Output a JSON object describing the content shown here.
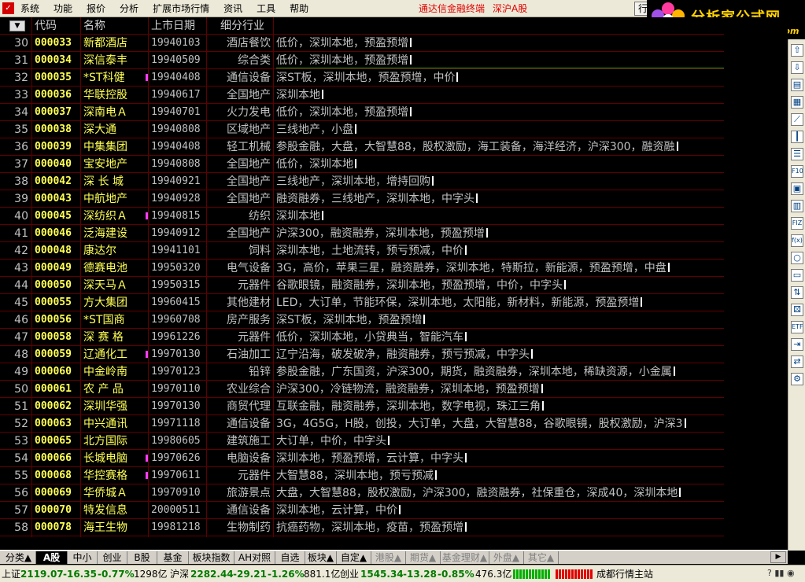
{
  "menu": {
    "app_icon": "app-logo-icon",
    "items": [
      "系统",
      "功能",
      "报价",
      "分析",
      "扩展市场行情",
      "资讯",
      "工具",
      "帮助"
    ],
    "title": "通达信金融终端",
    "market": "深沪A股",
    "market_button": "行"
  },
  "logo": {
    "title": "分析家公式网",
    "url": "www.88gs.com"
  },
  "table": {
    "sort_icon": "triangle-down-icon",
    "headers": {
      "code": "代码",
      "name": "名称",
      "date": "上市日期",
      "industry": "细分行业"
    },
    "rows": [
      {
        "no": "30",
        "code": "000033",
        "name": "新都酒店",
        "date": "19940103",
        "industry": "酒店餐饮",
        "notes": "低价，深圳本地，预盈预增",
        "flag": false
      },
      {
        "no": "31",
        "code": "000034",
        "name": "深信泰丰",
        "date": "19940509",
        "industry": "综合类",
        "notes": "低价，深圳本地，预盈预增",
        "flag": false
      },
      {
        "no": "32",
        "code": "000035",
        "name": "*ST科健",
        "date": "19940408",
        "industry": "通信设备",
        "notes": "深ST板，深圳本地，预盈预增，中价",
        "flag": true
      },
      {
        "no": "33",
        "code": "000036",
        "name": "华联控股",
        "date": "19940617",
        "industry": "全国地产",
        "notes": "深圳本地",
        "flag": false
      },
      {
        "no": "34",
        "code": "000037",
        "name": "深南电Ａ",
        "date": "19940701",
        "industry": "火力发电",
        "notes": "低价，深圳本地，预盈预增",
        "flag": false
      },
      {
        "no": "35",
        "code": "000038",
        "name": "深大通",
        "date": "19940808",
        "industry": "区域地产",
        "notes": "三线地产，小盘",
        "flag": false
      },
      {
        "no": "36",
        "code": "000039",
        "name": "中集集团",
        "date": "19940408",
        "industry": "轻工机械",
        "notes": "参股金融，大盘，大智慧88，股权激励，海工装备，海洋经济，沪深300，融资融",
        "flag": false
      },
      {
        "no": "37",
        "code": "000040",
        "name": "宝安地产",
        "date": "19940808",
        "industry": "全国地产",
        "notes": "低价，深圳本地",
        "flag": false
      },
      {
        "no": "38",
        "code": "000042",
        "name": "深 长 城",
        "date": "19940921",
        "industry": "全国地产",
        "notes": "三线地产，深圳本地，增持回购",
        "flag": false
      },
      {
        "no": "39",
        "code": "000043",
        "name": "中航地产",
        "date": "19940928",
        "industry": "全国地产",
        "notes": "融资融券，三线地产，深圳本地，中字头",
        "flag": false
      },
      {
        "no": "40",
        "code": "000045",
        "name": "深纺织Ａ",
        "date": "19940815",
        "industry": "纺织",
        "notes": "深圳本地",
        "flag": true
      },
      {
        "no": "41",
        "code": "000046",
        "name": "泛海建设",
        "date": "19940912",
        "industry": "全国地产",
        "notes": "沪深300，融资融券，深圳本地，预盈预增",
        "flag": false
      },
      {
        "no": "42",
        "code": "000048",
        "name": "康达尔",
        "date": "19941101",
        "industry": "饲料",
        "notes": "深圳本地，土地流转，预亏预减，中价",
        "flag": false
      },
      {
        "no": "43",
        "code": "000049",
        "name": "德赛电池",
        "date": "19950320",
        "industry": "电气设备",
        "notes": "3G，高价，苹果三星，融资融券，深圳本地，特斯拉，新能源，预盈预增，中盘",
        "flag": false
      },
      {
        "no": "44",
        "code": "000050",
        "name": "深天马Ａ",
        "date": "19950315",
        "industry": "元器件",
        "notes": "谷歌眼镜，融资融券，深圳本地，预盈预增，中价，中字头",
        "flag": false
      },
      {
        "no": "45",
        "code": "000055",
        "name": "方大集团",
        "date": "19960415",
        "industry": "其他建材",
        "notes": "LED，大订单，节能环保，深圳本地，太阳能，新材料，新能源，预盈预增",
        "flag": false
      },
      {
        "no": "46",
        "code": "000056",
        "name": "*ST国商",
        "date": "19960708",
        "industry": "房产服务",
        "notes": "深ST板，深圳本地，预盈预增",
        "flag": false
      },
      {
        "no": "47",
        "code": "000058",
        "name": "深 赛 格",
        "date": "19961226",
        "industry": "元器件",
        "notes": "低价，深圳本地，小贷典当，智能汽车",
        "flag": false
      },
      {
        "no": "48",
        "code": "000059",
        "name": "辽通化工",
        "date": "19970130",
        "industry": "石油加工",
        "notes": "辽宁沿海，破发破净，融资融券，预亏预减，中字头",
        "flag": true
      },
      {
        "no": "49",
        "code": "000060",
        "name": "中金岭南",
        "date": "19970123",
        "industry": "铅锌",
        "notes": "参股金融，广东国资，沪深300，期货，融资融券，深圳本地，稀缺资源，小金属",
        "flag": false
      },
      {
        "no": "50",
        "code": "000061",
        "name": "农 产 品",
        "date": "19970110",
        "industry": "农业综合",
        "notes": "沪深300，冷链物流，融资融券，深圳本地，预盈预增",
        "flag": false
      },
      {
        "no": "51",
        "code": "000062",
        "name": "深圳华强",
        "date": "19970130",
        "industry": "商贸代理",
        "notes": "互联金融，融资融券，深圳本地，数字电视，珠江三角",
        "flag": false
      },
      {
        "no": "52",
        "code": "000063",
        "name": "中兴通讯",
        "date": "19971118",
        "industry": "通信设备",
        "notes": "3G，4G5G，H股，创投，大订单，大盘，大智慧88，谷歌眼镜，股权激励，沪深3",
        "flag": false
      },
      {
        "no": "53",
        "code": "000065",
        "name": "北方国际",
        "date": "19980605",
        "industry": "建筑施工",
        "notes": "大订单，中价，中字头",
        "flag": false
      },
      {
        "no": "54",
        "code": "000066",
        "name": "长城电脑",
        "date": "19970626",
        "industry": "电脑设备",
        "notes": "深圳本地，预盈预增，云计算，中字头",
        "flag": true
      },
      {
        "no": "55",
        "code": "000068",
        "name": "华控赛格",
        "date": "19970611",
        "industry": "元器件",
        "notes": "大智慧88，深圳本地，预亏预减",
        "flag": true
      },
      {
        "no": "56",
        "code": "000069",
        "name": "华侨城Ａ",
        "date": "19970910",
        "industry": "旅游景点",
        "notes": "大盘，大智慧88，股权激励，沪深300，融资融券，社保重仓，深成40，深圳本地",
        "flag": false
      },
      {
        "no": "57",
        "code": "000070",
        "name": "特发信息",
        "date": "20000511",
        "industry": "通信设备",
        "notes": "深圳本地，云计算，中价",
        "flag": false
      },
      {
        "no": "58",
        "code": "000078",
        "name": "海王生物",
        "date": "19981218",
        "industry": "生物制药",
        "notes": "抗癌药物，深圳本地，疫苗，预盈预增",
        "flag": false
      }
    ]
  },
  "sidebar": {
    "buttons": [
      "up-arrow-icon",
      "down-arrow-icon",
      "report-icon",
      "grid-icon",
      "line-chart-icon",
      "candle-chart-icon",
      "list-icon",
      "f10-icon",
      "book-icon",
      "calendar-icon",
      "fiz-icon",
      "formula-icon",
      "circle-icon",
      "folder-icon",
      "sort-arrows-icon",
      "dice-icon",
      "etf-icon",
      "login-icon",
      "switch-icon",
      "settings-icon"
    ],
    "labels": {
      "f10-icon": "F10",
      "fiz-icon": "FIZ",
      "etf-icon": "ETF",
      "formula-icon": "f(x)"
    }
  },
  "tabs": [
    {
      "label": "分类▲",
      "state": "normal"
    },
    {
      "label": "A股",
      "state": "active"
    },
    {
      "label": "中小",
      "state": "normal"
    },
    {
      "label": "创业",
      "state": "normal"
    },
    {
      "label": "B股",
      "state": "normal"
    },
    {
      "label": "基金",
      "state": "normal"
    },
    {
      "label": "板块指数",
      "state": "normal"
    },
    {
      "label": "AH对照",
      "state": "normal"
    },
    {
      "label": "自选",
      "state": "normal"
    },
    {
      "label": "板块▲",
      "state": "normal"
    },
    {
      "label": "自定▲",
      "state": "normal"
    },
    {
      "label": "港股▲",
      "state": "dim"
    },
    {
      "label": "期货▲",
      "state": "dim"
    },
    {
      "label": "基金理财▲",
      "state": "dim"
    },
    {
      "label": "外盘▲",
      "state": "dim"
    },
    {
      "label": "其它▲",
      "state": "dim"
    }
  ],
  "status": {
    "sh_label": "上证",
    "sh_value": "2119.07",
    "sh_change": "-16.35",
    "sh_pct": "-0.77%",
    "sh_amount": "1298亿",
    "hs_label": "沪深",
    "hs_value": "2282.44",
    "hs_change": "-29.21",
    "hs_pct": "-1.26%",
    "hs_amount": "881.1亿",
    "cy_label": "创业",
    "cy_value": "1545.34",
    "cy_change": "-13.28",
    "cy_pct": "-0.85%",
    "cy_amount": "476.3亿",
    "site": "成都行情主站",
    "colors": {
      "up": "#e00000",
      "down": "#007a00",
      "meter_green": "#00b000",
      "meter_red": "#e00000"
    }
  }
}
